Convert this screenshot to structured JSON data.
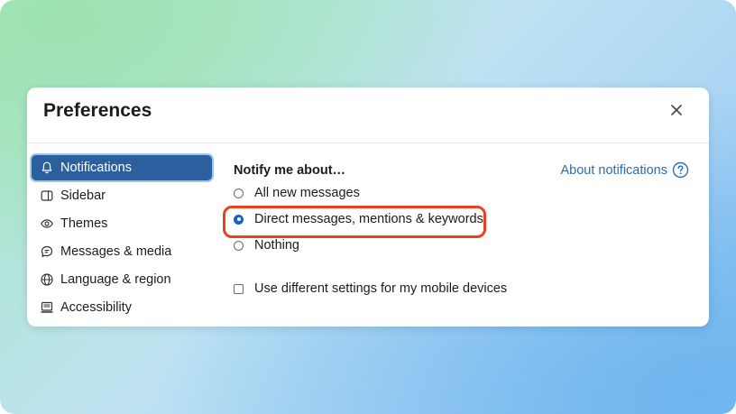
{
  "dialog": {
    "title": "Preferences",
    "close_icon": "close-icon"
  },
  "sidebar": {
    "items": [
      {
        "label": "Notifications",
        "icon": "bell-icon",
        "active": true
      },
      {
        "label": "Sidebar",
        "icon": "sidebar-icon",
        "active": false
      },
      {
        "label": "Themes",
        "icon": "eye-icon",
        "active": false
      },
      {
        "label": "Messages & media",
        "icon": "message-icon",
        "active": false
      },
      {
        "label": "Language & region",
        "icon": "globe-icon",
        "active": false
      },
      {
        "label": "Accessibility",
        "icon": "keyboard-icon",
        "active": false
      }
    ],
    "active_color": "#2b5f9e"
  },
  "notifications": {
    "heading": "Notify me about…",
    "about_link": "About notifications",
    "about_icon": "help-circle-icon",
    "options": [
      {
        "label": "All new messages",
        "checked": false
      },
      {
        "label": "Direct messages, mentions & keywords",
        "checked": true
      },
      {
        "label": "Nothing",
        "checked": false
      }
    ],
    "mobile_checkbox": {
      "label": "Use different settings for my mobile devices",
      "checked": false
    },
    "highlight_color": "#e8421f"
  }
}
